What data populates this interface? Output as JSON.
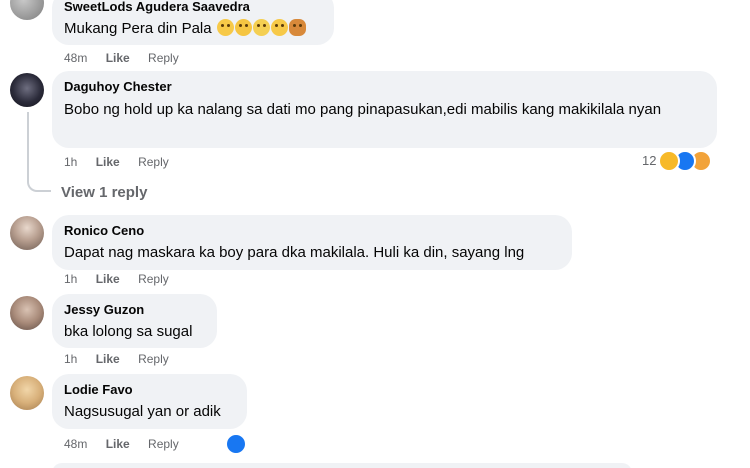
{
  "comments": [
    {
      "author": "SweetLods Agudera Saavedra",
      "text": "Mukang Pera din Pala",
      "emoji": [
        "laugh-tears-icon",
        "grin-sweat-icon",
        "relieved-icon",
        "smile-icon",
        "person-emoji-icon"
      ],
      "time": "48m",
      "like": "Like",
      "reply": "Reply"
    },
    {
      "author": "Daguhoy Chester",
      "text": "Bobo ng hold up ka nalang sa dati mo pang pinapasukan,edi mabilis kang makikilala nyan",
      "time": "1h",
      "like": "Like",
      "reply": "Reply",
      "reactions_count": "12",
      "reactions": [
        "haha-icon",
        "like-icon",
        "care-icon"
      ],
      "view_replies": "View 1 reply"
    },
    {
      "author": "Ronico Ceno",
      "text": "Dapat nag maskara ka boy para dka makilala. Huli ka din, sayang lng",
      "time": "1h",
      "like": "Like",
      "reply": "Reply"
    },
    {
      "author": "Jessy Guzon",
      "text": "bka lolong sa sugal",
      "time": "1h",
      "like": "Like",
      "reply": "Reply"
    },
    {
      "author": "Lodie Favo",
      "text": "Nagsusugal yan or adik",
      "time": "48m",
      "like": "Like",
      "reply": "Reply",
      "reactions": [
        "like-icon"
      ]
    }
  ],
  "colors": {
    "bubble": "#f0f2f5",
    "meta": "#65676b",
    "like_blue": "#1877f2",
    "haha_yellow": "#f7b928"
  }
}
